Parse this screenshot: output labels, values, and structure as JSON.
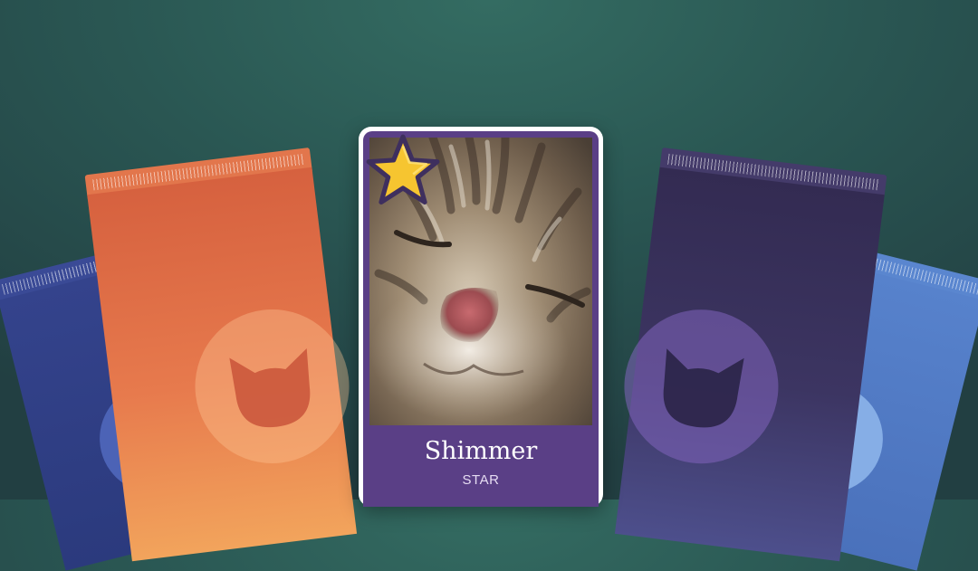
{
  "card": {
    "name": "Shimmer",
    "rarity": "STAR",
    "image": "sleeping-tabby-kitten-closeup"
  },
  "packs": [
    {
      "id": "far-left",
      "color": "#34438c"
    },
    {
      "id": "orange",
      "color": "#e2764c"
    },
    {
      "id": "purple",
      "color": "#3c3562"
    },
    {
      "id": "far-right",
      "color": "#5782cc"
    }
  ],
  "colors": {
    "background": "#2a5753",
    "card_frame": "#5a3f86",
    "star": "#f6c530"
  },
  "icons": {
    "pack_emblem": "cat-head-icon",
    "badge": "star-icon"
  }
}
